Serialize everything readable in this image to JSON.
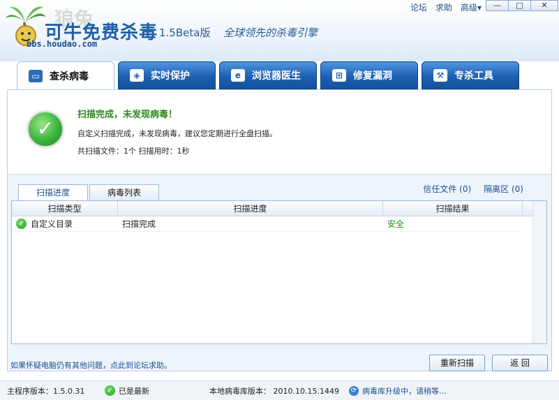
{
  "header": {
    "watermark_text": "狼兔",
    "title": "可牛免费杀毒",
    "version": "1.5Beta版",
    "slogan": "全球领先的杀毒引擎",
    "url": "bbs.houdao.com",
    "links": [
      "论坛",
      "求助",
      "高级▾"
    ],
    "window_controls": [
      "—",
      "□",
      "✕"
    ]
  },
  "tabs": [
    {
      "label": "查杀病毒",
      "icon": "monitor-icon",
      "active": true
    },
    {
      "label": "实时保护",
      "icon": "shield-icon",
      "active": false
    },
    {
      "label": "浏览器医生",
      "icon": "ie-icon",
      "active": false
    },
    {
      "label": "修复漏洞",
      "icon": "windows-icon",
      "active": false
    },
    {
      "label": "专杀工具",
      "icon": "tools-icon",
      "active": false
    }
  ],
  "result": {
    "title": "扫描完成，未发现病毒！",
    "description": "自定义扫描完成，未发现病毒，建议您定期进行全盘扫描。",
    "stats": "共扫描文件：1个  扫描用时：1秒"
  },
  "sub_tabs": [
    "扫描进度",
    "病毒列表"
  ],
  "right_links": [
    "信任文件 (0)",
    "隔离区 (0)"
  ],
  "table": {
    "columns": [
      "扫描类型",
      "扫描进度",
      "扫描结果"
    ],
    "rows": [
      {
        "type": "自定义目录",
        "progress": "扫描完成",
        "result": "安全"
      }
    ]
  },
  "footer": {
    "forum_hint": "如果怀疑电脑仍有其他问题，点此到论坛求助。",
    "rescan_label": "重新扫描",
    "back_label": "返 回"
  },
  "statusbar": {
    "program_version": "主程序版本：1.5.0.31",
    "up_to_date": "已是最新",
    "db_version": "本地病毒库版本： 2010.10.15.1449",
    "upgrading": "病毒库升级中，请稍等…"
  },
  "colors": {
    "accent_blue": "#1d5fb2",
    "ok_green": "#2a8a1a"
  }
}
